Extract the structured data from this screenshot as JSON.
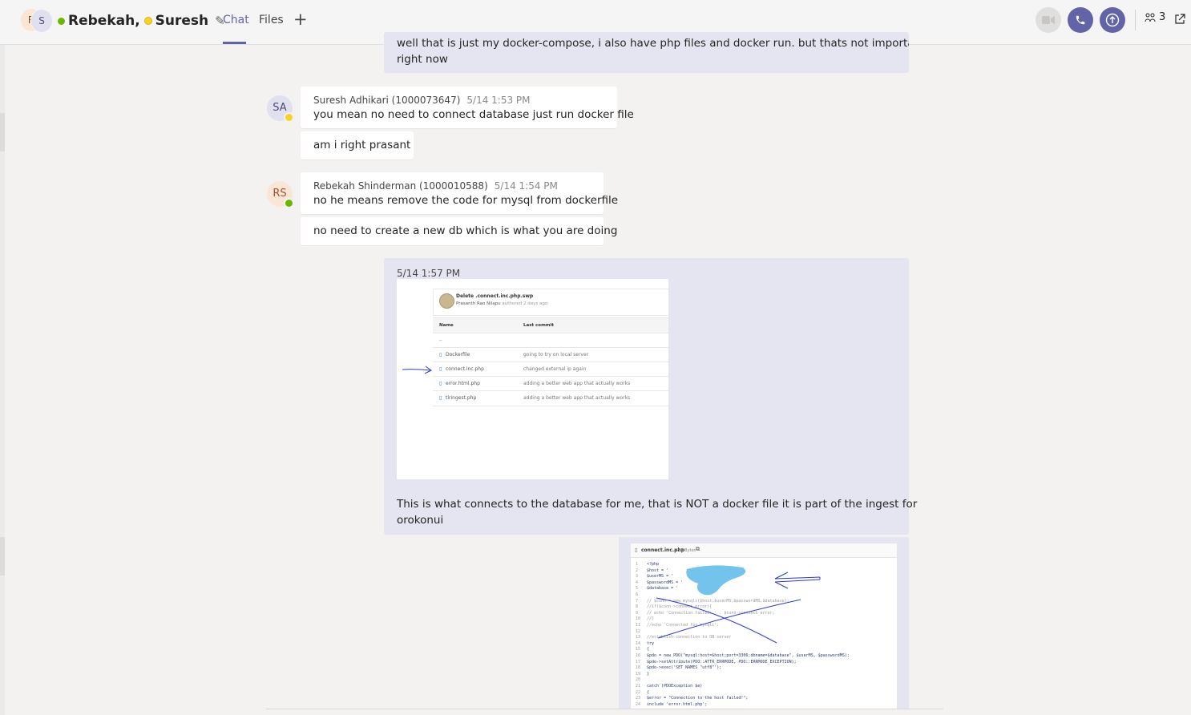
{
  "header": {
    "avatar_initials": [
      "R",
      "S"
    ],
    "title_first": "Rebekah,",
    "title_second": "Suresh",
    "tabs": [
      {
        "label": "Chat",
        "active": true
      },
      {
        "label": "Files",
        "active": false
      }
    ],
    "participants_count": "3"
  },
  "messages": [
    {
      "self": true,
      "text_line1": "well that is just my docker-compose, i also have php files and docker run. but thats not important",
      "text_line2": "right now"
    },
    {
      "author_initials": "SA",
      "author": "Suresh Adhikari (1000073647)",
      "time": "5/14 1:53 PM",
      "status": "away",
      "lines": [
        "you mean no need to connect database just run docker file",
        "am i right prasant"
      ]
    },
    {
      "author_initials": "RS",
      "author": "Rebekah Shinderman (1000010588)",
      "time": "5/14 1:54 PM",
      "status": "available",
      "lines": [
        "no he means remove the code for mysql from dockerfile",
        "no need to create a new db which is what you are doing"
      ]
    },
    {
      "self": true,
      "time": "5/14 1:57 PM",
      "text_line1": "This is what connects to the database for me, that is NOT a docker file it is part of the ingest for",
      "text_line2": "orokonui"
    }
  ],
  "repo_screenshot": {
    "commit_title": "Delete .connect.inc.php.swp",
    "commit_author": "Prasanth Rao Nilapu",
    "commit_meta": "authored 2 days ago",
    "col_name": "Name",
    "col_commit": "Last commit",
    "parent_dir": "..",
    "files": [
      {
        "name": "Dockerfile",
        "commit": "going to try on local server"
      },
      {
        "name": "connect.inc.php",
        "commit": "changed external ip again"
      },
      {
        "name": "error.html.php",
        "commit": "adding a better web app that actually works"
      },
      {
        "name": "tlringest.php",
        "commit": "adding a better web app that actually works"
      }
    ]
  },
  "code_screenshot": {
    "filename": "connect.inc.php",
    "size": "695 Bytes",
    "lines": [
      "<?php",
      "    $host = '",
      "    $userMS = '",
      "    $passwordMS = '",
      "    $database = '",
      "",
      "    // $conn = new mysqli($host,$userMS,$passwordMS,$database);",
      "    //if($conn->connect_error){",
      "    //    echo 'Connection failed: ' . $conn->connect_error;",
      "    //}",
      "    //echo 'Connected for mysqli';",
      "",
      "    //establish connection to DB server",
      "    try",
      "    {",
      "        $pdo = new PDO(\"mysql:host=$host;port=3306;dbname=$database\", $userMS, $passwordMS);",
      "        $pdo->setAttribute(PDO::ATTR_ERRMODE, PDO::ERRMODE_EXCEPTION);",
      "        $pdo->exec('SET NAMES \"utf8\"');",
      "    }",
      "",
      "    catch (PDOException $e)",
      "    {",
      "        $error = \"Connection to the host failed!\";",
      "        include 'error.html.php';"
    ]
  },
  "colors": {
    "accent": "#6264a7",
    "self_bubble": "#e5e5f1",
    "available": "#6bb700",
    "away": "#f8d22a"
  }
}
